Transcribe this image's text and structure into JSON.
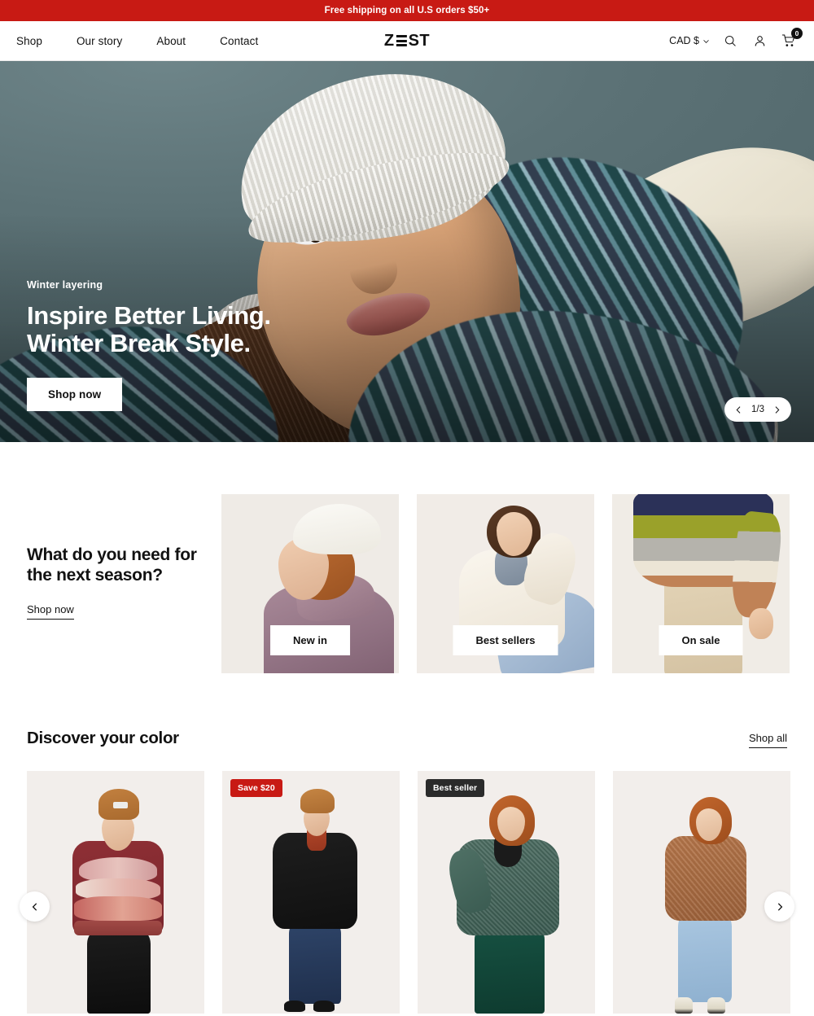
{
  "announcement": {
    "text": "Free shipping on all U.S orders $50+",
    "background": "#c81a14"
  },
  "header": {
    "nav": [
      {
        "label": "Shop"
      },
      {
        "label": "Our story"
      },
      {
        "label": "About"
      },
      {
        "label": "Contact"
      }
    ],
    "logo": {
      "prefix": "Z",
      "suffix": "ST",
      "alt": "ZEST"
    },
    "currency": {
      "label": "CAD $"
    },
    "icons": {
      "search": "search-icon",
      "account": "account-icon",
      "cart": "cart-icon"
    },
    "cart_count": "0"
  },
  "hero": {
    "eyebrow": "Winter layering",
    "title_line1": "Inspire Better Living.",
    "title_line2": "Winter Break Style.",
    "cta": "Shop now",
    "pager": {
      "count": "1/3",
      "prev": "chevron-left-icon",
      "next": "chevron-right-icon"
    }
  },
  "categories": {
    "title_line1": "What do you need for",
    "title_line2": "the next season?",
    "link": "Shop now",
    "cards": [
      {
        "label": "New in"
      },
      {
        "label": "Best sellers"
      },
      {
        "label": "On sale"
      }
    ]
  },
  "products": {
    "title": "Discover your color",
    "link": "Shop all",
    "items": [
      {
        "badge": "",
        "badge_type": ""
      },
      {
        "badge": "Save $20",
        "badge_type": "sale"
      },
      {
        "badge": "Best seller",
        "badge_type": "best"
      },
      {
        "badge": "",
        "badge_type": ""
      }
    ],
    "prev": "chevron-left-icon",
    "next": "chevron-right-icon"
  },
  "colors": {
    "accent_red": "#c81a14",
    "ink": "#121212",
    "badge_dark": "#2b2b2b"
  }
}
